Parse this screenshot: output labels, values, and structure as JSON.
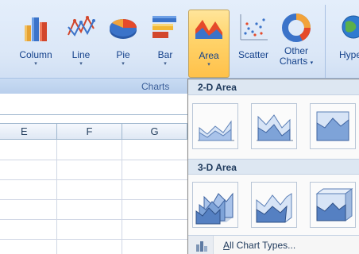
{
  "ribbon": {
    "group_label": "Charts",
    "buttons": [
      {
        "label": "Column",
        "icon": "column-chart-icon"
      },
      {
        "label": "Line",
        "icon": "line-chart-icon"
      },
      {
        "label": "Pie",
        "icon": "pie-chart-icon"
      },
      {
        "label": "Bar",
        "icon": "bar-chart-icon"
      },
      {
        "label": "Area",
        "icon": "area-chart-icon",
        "active": true
      },
      {
        "label": "Scatter",
        "icon": "scatter-chart-icon"
      },
      {
        "label_line1": "Other",
        "label_line2": "Charts",
        "icon": "other-charts-icon"
      },
      {
        "label": "Hype",
        "icon": "hyperlink-icon"
      }
    ],
    "dropdown_arrow": "▾"
  },
  "sheet": {
    "columns": [
      "E",
      "F",
      "G"
    ]
  },
  "dropdown": {
    "section_2d": "2-D Area",
    "section_3d": "3-D Area",
    "all_chart_types_mnemonic": "A",
    "all_chart_types_rest": "ll Chart Types...",
    "thumbnails_2d": [
      "area-icon",
      "stacked-area-icon",
      "100-percent-stacked-area-icon"
    ],
    "thumbnails_3d": [
      "3d-area-icon",
      "3d-stacked-area-icon",
      "3d-100-percent-stacked-area-icon"
    ]
  },
  "colors": {
    "accent_active": "#ffd36a",
    "ribbon_bg": "#dbe7f7",
    "text": "#15428b"
  }
}
